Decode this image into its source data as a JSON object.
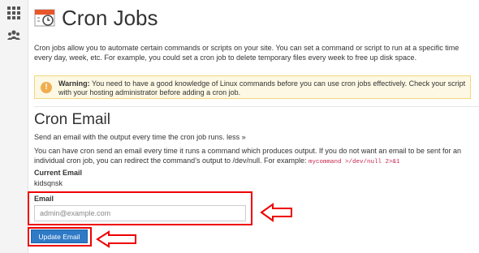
{
  "sidebar": {
    "icons": [
      "grid-icon",
      "users-icon"
    ]
  },
  "page": {
    "title": "Cron Jobs",
    "intro": "Cron jobs allow you to automate certain commands or scripts on your site. You can set a command or script to run at a specific time every day, week, etc. For example, you could set a cron job to delete temporary files every week to free up disk space."
  },
  "warning": {
    "label": "Warning:",
    "text": "You need to have a good knowledge of Linux commands before you can use cron jobs effectively. Check your script with your hosting administrator before adding a cron job."
  },
  "cron_email": {
    "heading": "Cron Email",
    "send_line": "Send an email with the output every time the cron job runs.",
    "less_link": "less »",
    "description": "You can have cron send an email every time it runs a command which produces output. If you do not want an email to be sent for an individual cron job, you can redirect the command’s output to /dev/null. For example:",
    "example_code": "mycommand >/dev/null 2>&1",
    "current_email_label": "Current Email",
    "current_email_value": "kidsqnsk",
    "email_label": "Email",
    "email_placeholder": "admin@example.com",
    "update_button": "Update Email"
  },
  "colors": {
    "accent": "#2f7ac6",
    "highlight": "#ee0000",
    "warning_bg": "#fdf8e4"
  }
}
